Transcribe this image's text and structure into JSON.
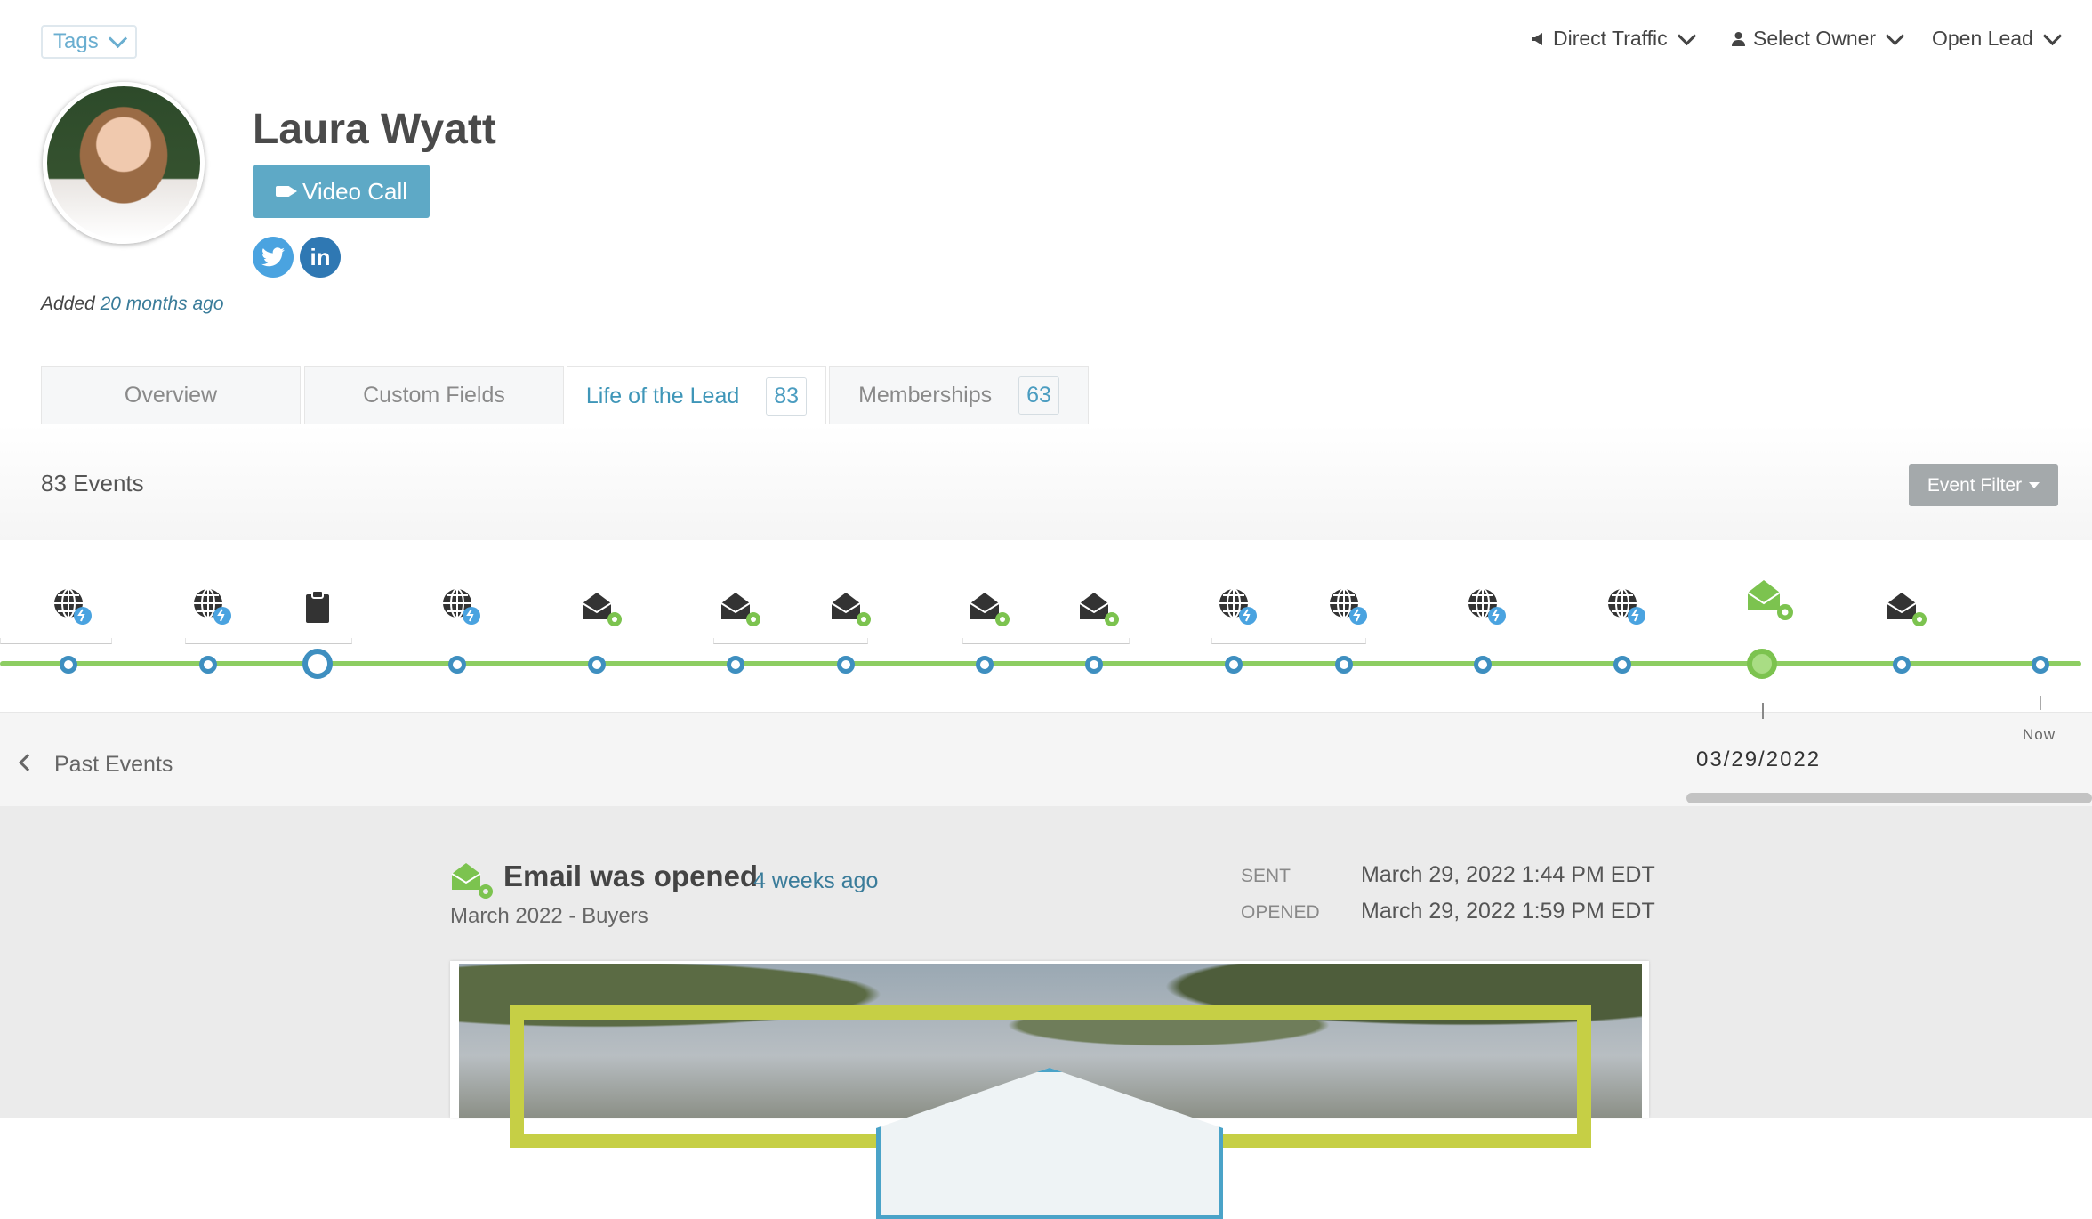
{
  "header": {
    "tags_label": "Tags",
    "menus": {
      "traffic": "Direct Traffic",
      "owner": "Select Owner",
      "status": "Open Lead"
    }
  },
  "profile": {
    "name": "Laura Wyatt",
    "video_call_label": "Video Call",
    "social": [
      "twitter",
      "linkedin"
    ],
    "added_prefix": "Added",
    "added_relative": "20 months ago"
  },
  "tabs": [
    {
      "label": "Overview",
      "count": ""
    },
    {
      "label": "Custom Fields",
      "count": ""
    },
    {
      "label": "Life of the Lead",
      "count": "83",
      "active": true
    },
    {
      "label": "Memberships",
      "count": "63"
    }
  ],
  "events": {
    "count_label": "83 Events",
    "filter_label": "Event Filter",
    "past_label": "Past Events",
    "selected_date": "03/29/2022",
    "now_label": "Now",
    "timeline_icons": [
      "web-visit-icon",
      "web-visit-icon",
      "form-icon",
      "web-visit-icon",
      "email-auto-icon",
      "email-auto-icon",
      "email-auto-icon",
      "email-auto-icon",
      "email-auto-icon",
      "web-visit-icon",
      "web-visit-icon",
      "web-visit-icon",
      "web-visit-icon",
      "email-opened-icon",
      "email-auto-icon"
    ]
  },
  "detail": {
    "title": "Email was opened",
    "relative": "4 weeks ago",
    "subtitle": "March 2022 - Buyers",
    "sent_label": "SENT",
    "sent_value": "March 29, 2022 1:44 PM EDT",
    "opened_label": "OPENED",
    "opened_value": "March 29, 2022 1:59 PM EDT"
  },
  "colors": {
    "accent": "#5ea9c6",
    "timeline_green": "#8dcd62",
    "node_blue": "#3e8fc0",
    "email_green": "#7cc34f"
  }
}
